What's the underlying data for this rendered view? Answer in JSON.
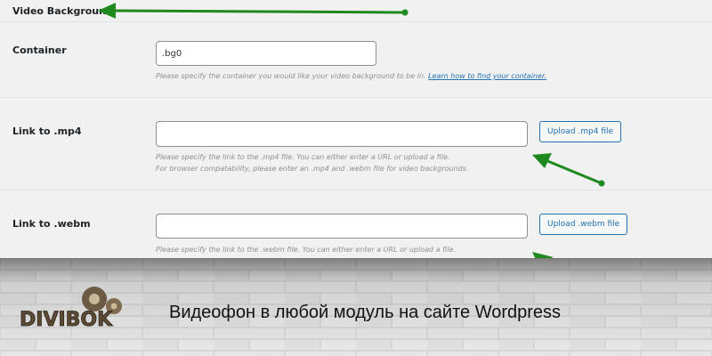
{
  "section": {
    "title": "Video Background"
  },
  "container": {
    "label": "Container",
    "value": ".bg0",
    "help_text": "Please specify the container you would like your video background to be in.",
    "help_link": "Learn how to find your container."
  },
  "mp4": {
    "label": "Link to .mp4",
    "value": "",
    "help_line1": "Please specify the link to the .mp4 file. You can either enter a URL or upload a file.",
    "help_line2": "For browser compatability, please enter an .mp4 and .webm file for video backgrounds.",
    "button_label": "Upload .mp4 file"
  },
  "webm": {
    "label": "Link to .webm",
    "value": "",
    "help_line1": "Please specify the link to the .webm file. You can either enter a URL or upload a file.",
    "button_label": "Upload .webm file"
  },
  "annotation_color": "#1e8a1e",
  "banner": {
    "logo_text": "DIVIBOK",
    "caption": "Видеофон в любой модуль на сайте Wordpress"
  }
}
